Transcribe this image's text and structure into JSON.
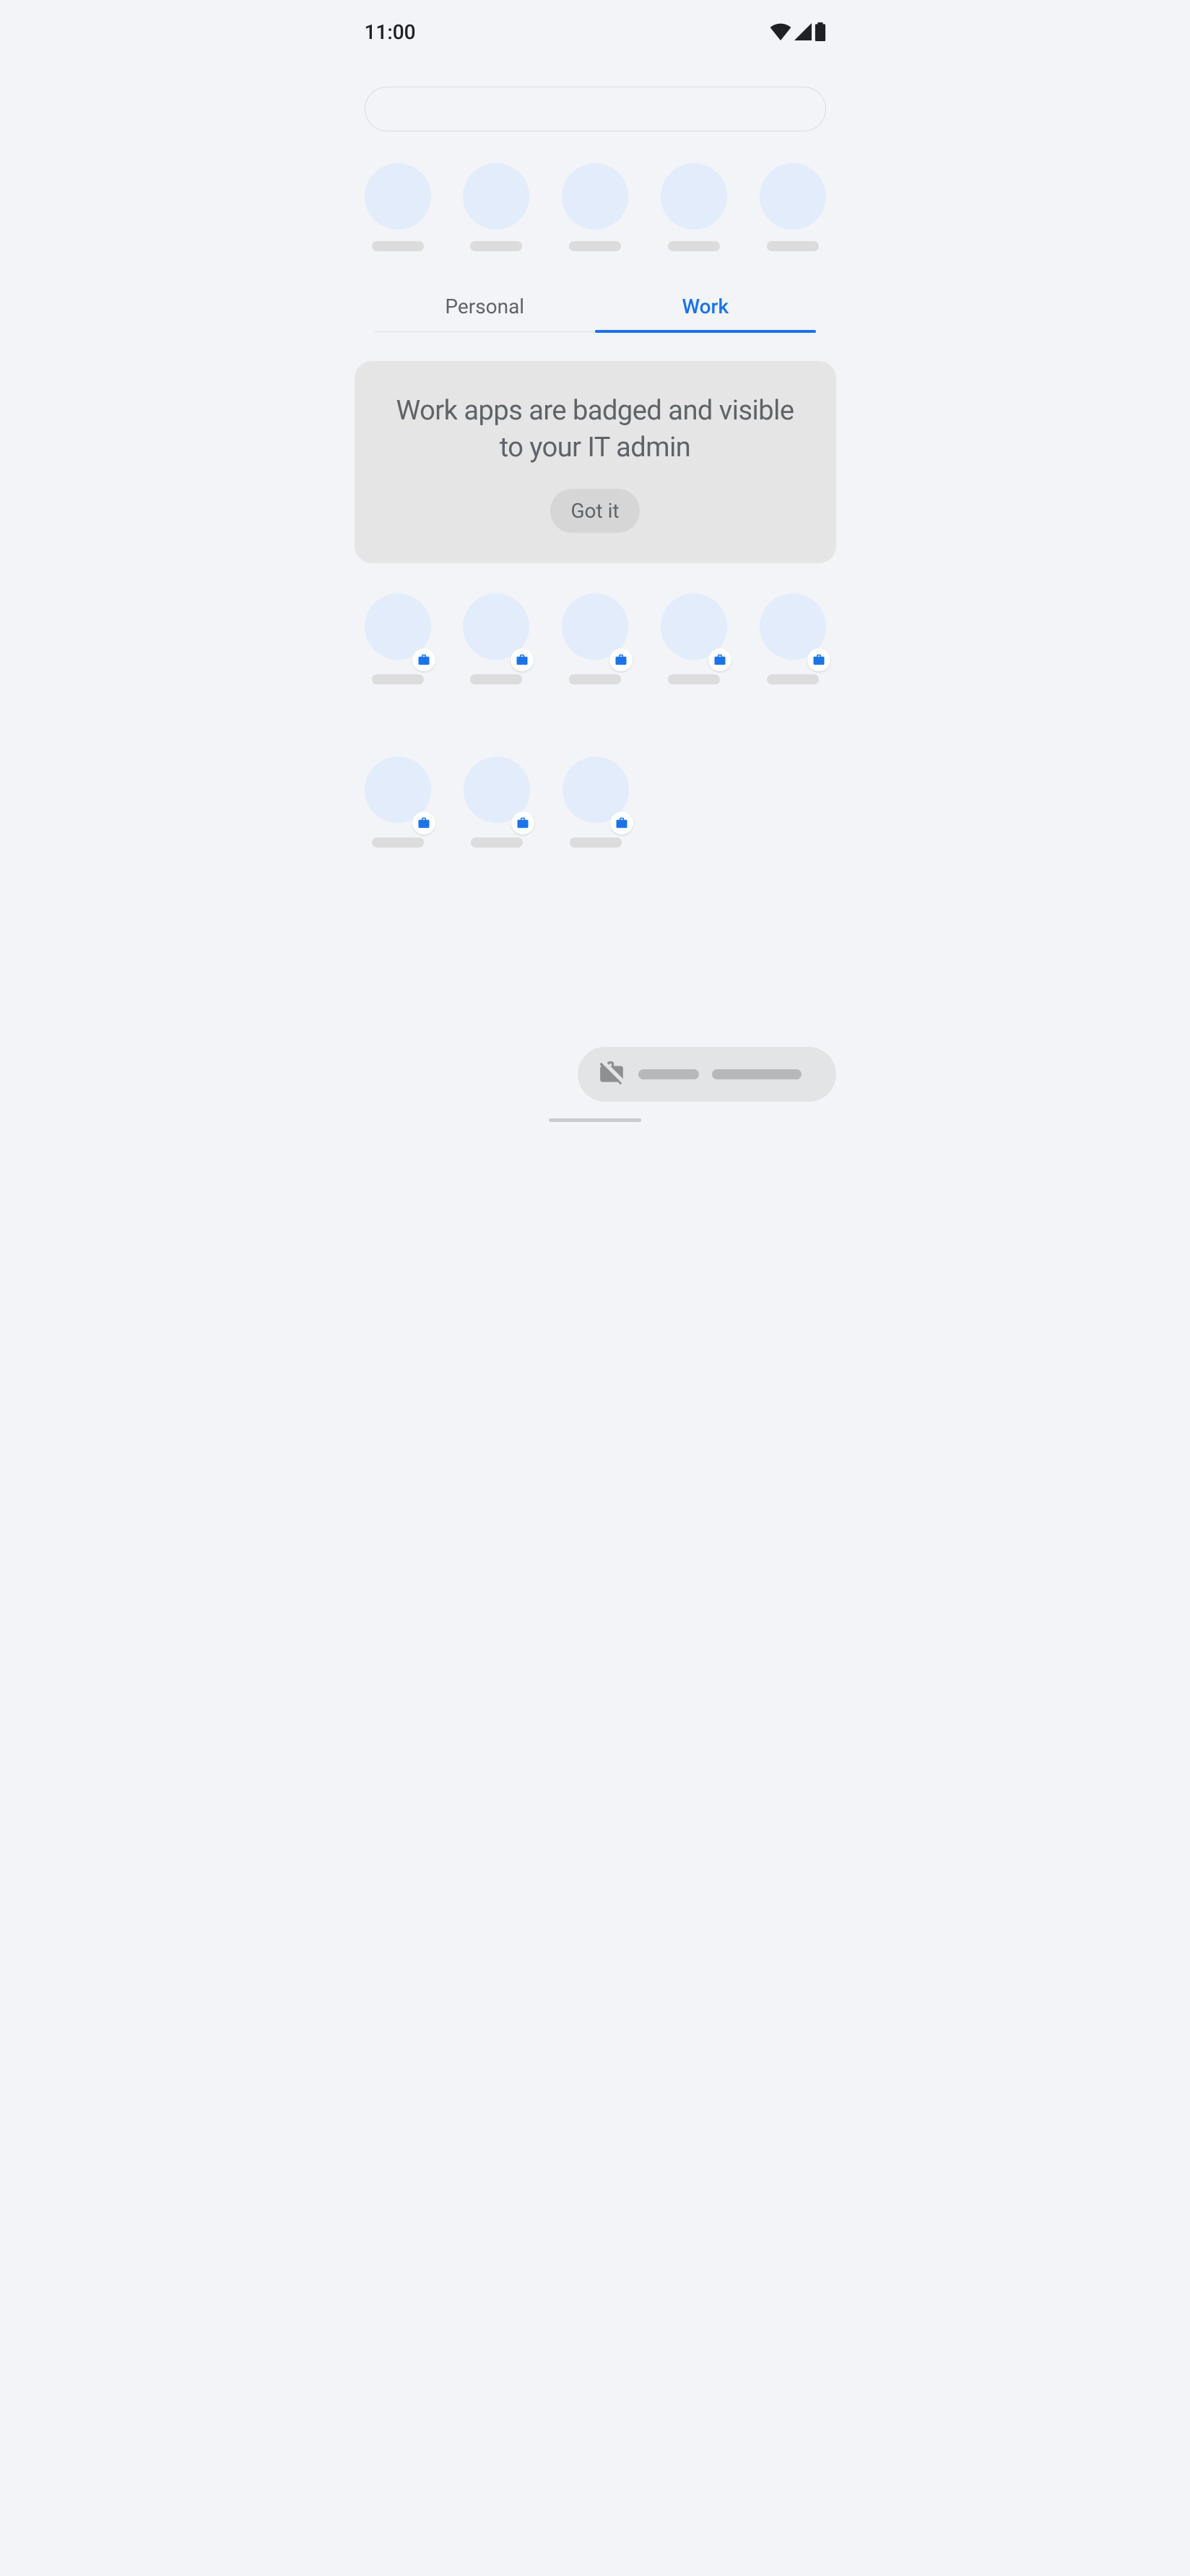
{
  "status": {
    "time": "11:00"
  },
  "tabs": {
    "personal": "Personal",
    "work": "Work",
    "active": "work"
  },
  "info_card": {
    "text": "Work apps are badged and visible to your IT admin",
    "button": "Got it"
  },
  "suggestion_count": 5,
  "work_app_count": 8
}
